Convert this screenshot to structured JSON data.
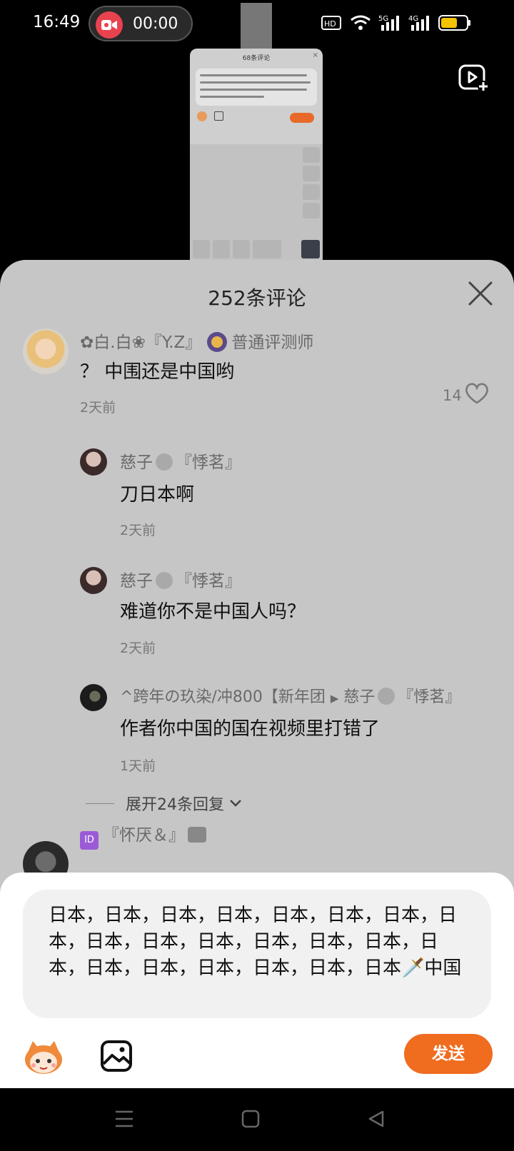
{
  "status_bar": {
    "time": "16:49",
    "recording_time": "00:00",
    "hd_label": "HD",
    "net1": "5G",
    "net2": "4G",
    "battery_color": "#f5c400",
    "record_color": "#e8424f"
  },
  "thumbnail": {
    "title": "68条评论",
    "close": "×"
  },
  "panel": {
    "title": "252条评论",
    "close_icon": "close-icon"
  },
  "comments": [
    {
      "name": "✿白.白❀『Y.Z』",
      "badge": "普通评测师",
      "text": "？ 中围还是中国哟",
      "time": "2天前",
      "likes": "14"
    },
    {
      "name_a": "慈子",
      "name_b": "『悸茗』",
      "text": "刀日本啊",
      "time": "2天前"
    },
    {
      "name_a": "慈子",
      "name_b": "『悸茗』",
      "text": "难道你不是中国人吗？",
      "time": "2天前"
    },
    {
      "name_a": "^跨年の玖染/冲800【新年团",
      "arrow": "▶",
      "name_b": "慈子",
      "name_c": "『悸茗』",
      "text": "作者你中国的国在视频里打错了",
      "time": "1天前"
    }
  ],
  "expand_replies": "展开24条回复",
  "next_comment": {
    "badge": "ID",
    "name": "『怀厌＆』"
  },
  "input": {
    "value": " 日本，日本，日本，日本，日本，日本，日本，日本，日本，日本，日本，日本，日本，日本，日本，日本，日本，日本，日本，日本，日本🗡️中国",
    "send_label": "发送",
    "send_color": "#f06c1f"
  },
  "nav": {
    "menu_icon": "menu-icon",
    "home_icon": "home-icon",
    "back_icon": "back-icon"
  }
}
